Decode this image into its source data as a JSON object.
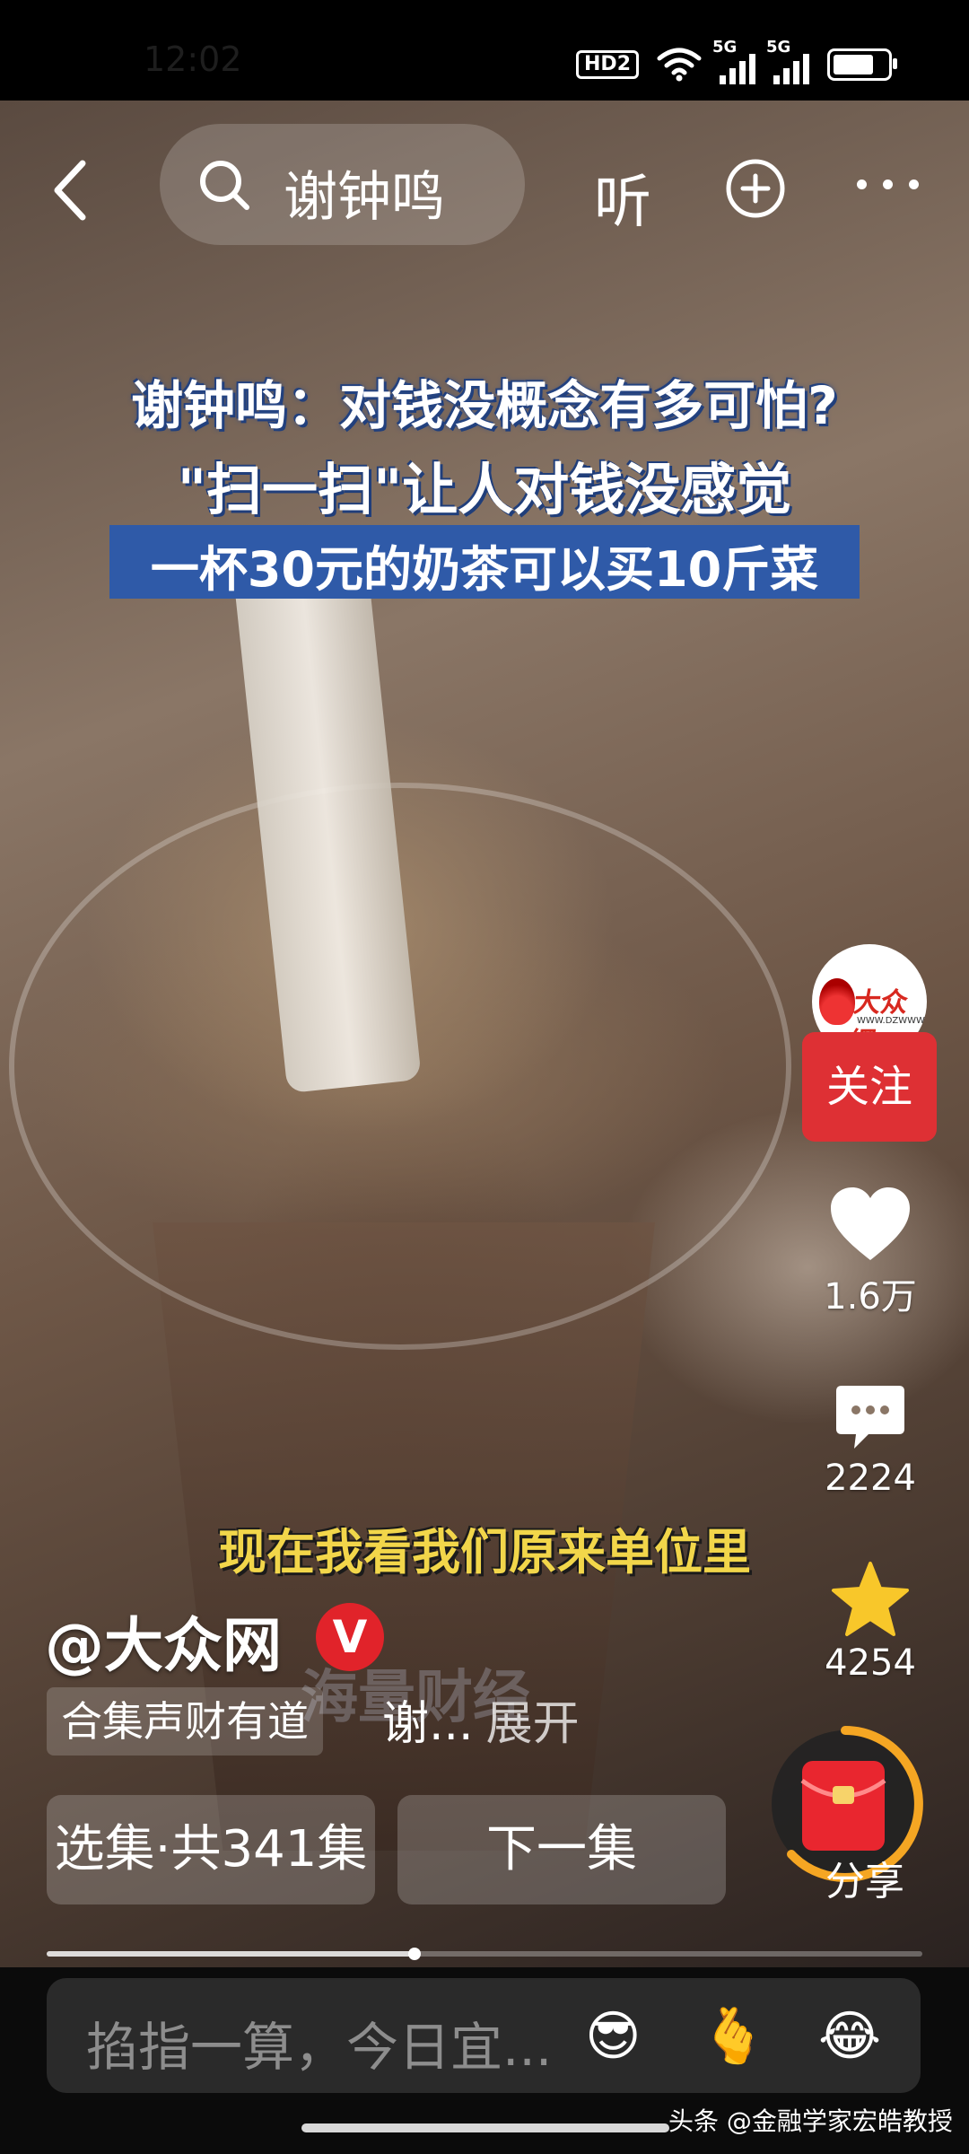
{
  "status_bar": {
    "time": "12:02",
    "hd_label": "HD2",
    "signal1_label": "5G",
    "signal2_label": "5G",
    "battery_level": 0.75
  },
  "top_bar": {
    "search_query": "谢钟鸣",
    "listen_label": "听"
  },
  "video": {
    "title_line1": "谢钟鸣：对钱没概念有多可怕?",
    "title_line2": "\"扫一扫\"让人对钱没感觉",
    "title_line3": "一杯30元的奶茶可以买10斤菜",
    "subtitle": "现在我看我们原来单位里",
    "watermark": "海量财经",
    "progress": 0.42
  },
  "creator": {
    "handle": "@大众网",
    "verified_badge": "V",
    "avatar_logo_text": "大众網",
    "avatar_logo_url": "WWW.DZWWW.COM",
    "follow_label": "关注"
  },
  "actions": {
    "likes": "1.6万",
    "comments": "2224",
    "favorites": "4254",
    "share_label": "分享"
  },
  "info": {
    "collection_tag": "合集声财有道",
    "description": "谢...",
    "expand_label": "展开",
    "episode_select_label": "选集·共341集",
    "next_episode_label": "下一集"
  },
  "comment_bar": {
    "placeholder": "掐指一算，今日宜...",
    "emoji_1": "😎",
    "emoji_2": "🫰",
    "emoji_3": "😂"
  },
  "source_watermark": "头条 @金融学家宏皓教授"
}
